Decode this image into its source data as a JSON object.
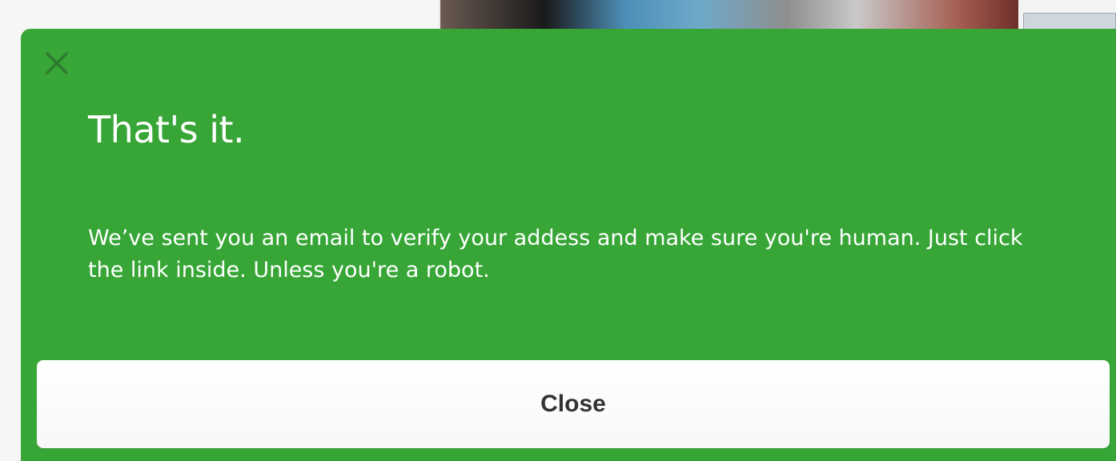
{
  "modal": {
    "title": "That's it.",
    "message": "We’ve sent you an email to verify your addess and make sure you're human. Just click the link inside. Unless you're a robot.",
    "close_button_label": "Close",
    "close_icon": "close-icon",
    "background_color": "#37a637",
    "icon_color": "#2e7a2e"
  }
}
